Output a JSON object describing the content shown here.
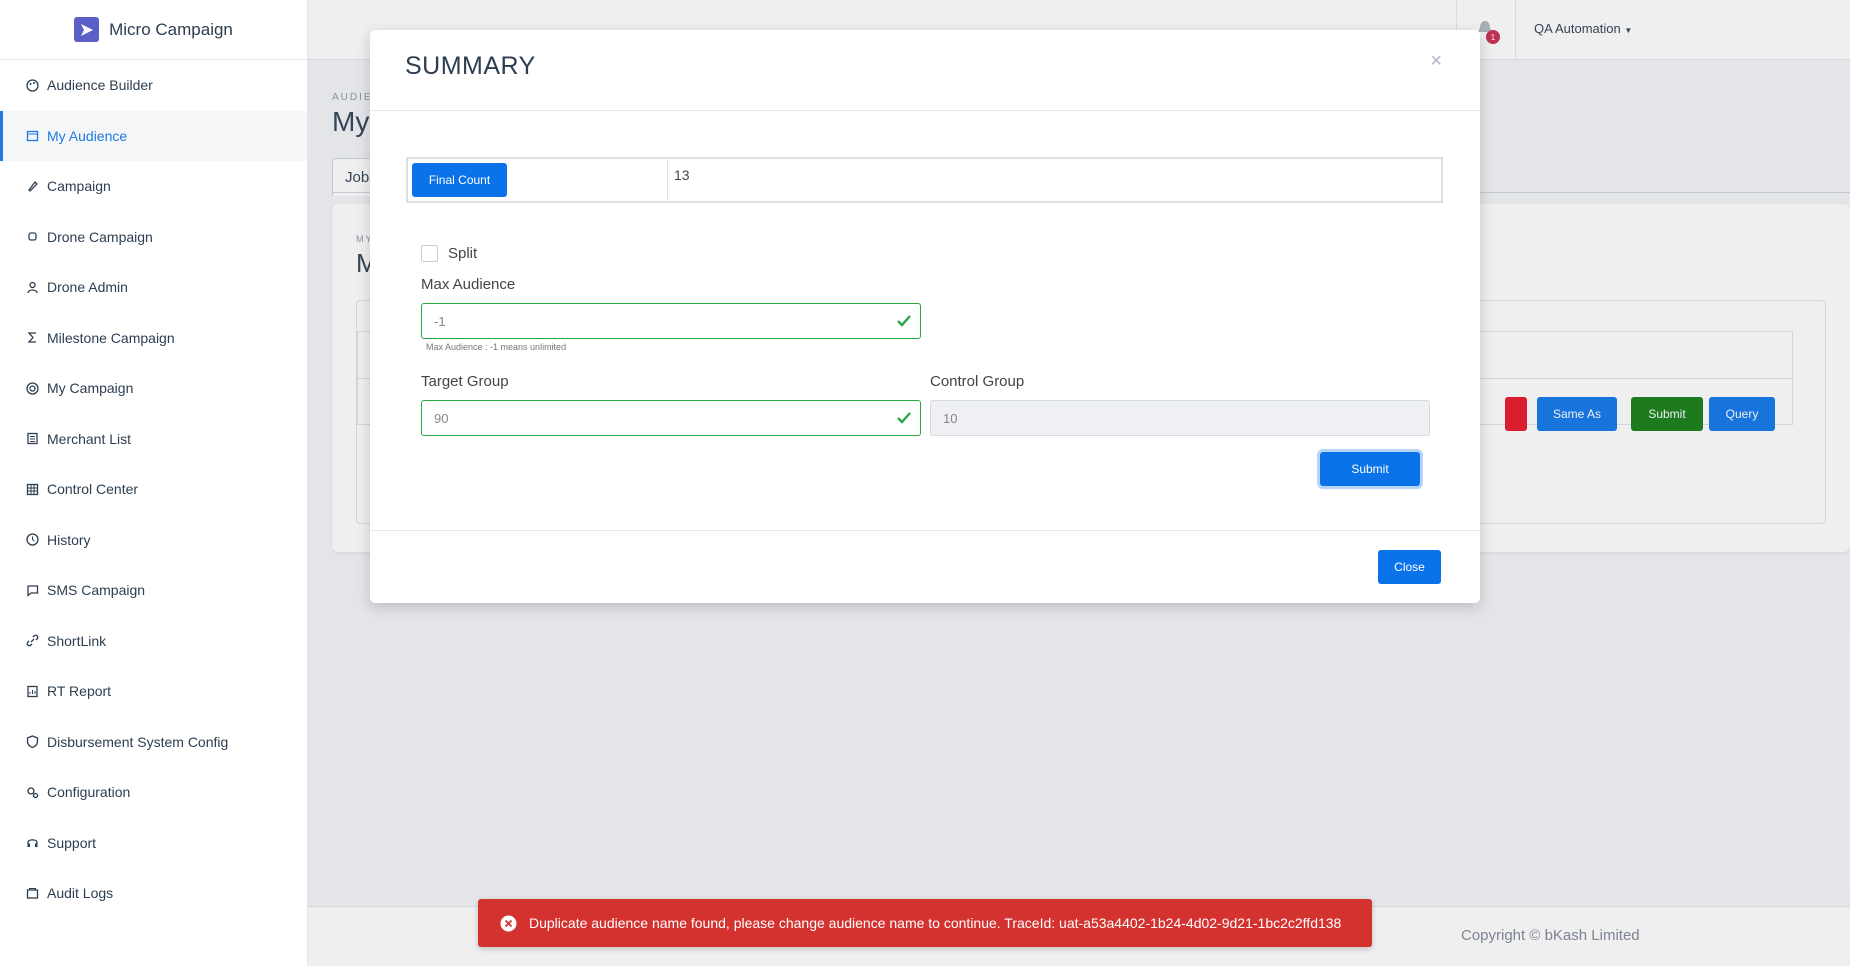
{
  "brand": {
    "name": "Micro Campaign"
  },
  "sidebar": {
    "items": [
      {
        "label": "Audience Builder",
        "icon": "palette-icon",
        "active": false
      },
      {
        "label": "My Audience",
        "icon": "calendar-icon",
        "active": true
      },
      {
        "label": "Campaign",
        "icon": "rocket-icon",
        "active": false
      },
      {
        "label": "Drone Campaign",
        "icon": "drone-icon",
        "active": false
      },
      {
        "label": "Drone Admin",
        "icon": "user-icon",
        "active": false
      },
      {
        "label": "Milestone Campaign",
        "icon": "sigma-icon",
        "active": false
      },
      {
        "label": "My Campaign",
        "icon": "target-icon",
        "active": false
      },
      {
        "label": "Merchant List",
        "icon": "list-icon",
        "active": false
      },
      {
        "label": "Control Center",
        "icon": "grid-icon",
        "active": false
      },
      {
        "label": "History",
        "icon": "history-icon",
        "active": false
      },
      {
        "label": "SMS Campaign",
        "icon": "message-icon",
        "active": false
      },
      {
        "label": "ShortLink",
        "icon": "link-icon",
        "active": false
      },
      {
        "label": "RT Report",
        "icon": "report-icon",
        "active": false
      },
      {
        "label": "Disbursement System Config",
        "icon": "shield-icon",
        "active": false
      },
      {
        "label": "Configuration",
        "icon": "gears-icon",
        "active": false
      },
      {
        "label": "Support",
        "icon": "headset-icon",
        "active": false
      },
      {
        "label": "Audit Logs",
        "icon": "audit-icon",
        "active": false
      }
    ]
  },
  "topbar": {
    "notification_count": "1",
    "user_name": "QA Automation"
  },
  "background": {
    "title_small": "AUDIE",
    "title": "My",
    "tab_label": "Jobs",
    "card_small": "MY",
    "card_title": "M",
    "buttons": {
      "same_as": "Same As",
      "submit": "Submit",
      "query": "Query"
    }
  },
  "modal": {
    "title": "SUMMARY",
    "close_symbol": "×",
    "final_count_label": "Final Count",
    "final_count_value": "13",
    "split_label": "Split",
    "max_audience_label": "Max Audience",
    "max_audience_value": "-1",
    "max_audience_help": "Max Audience : -1 means unlimited",
    "target_group_label": "Target Group",
    "target_group_value": "90",
    "control_group_label": "Control Group",
    "control_group_value": "10",
    "submit_label": "Submit",
    "close_label": "Close"
  },
  "toast": {
    "message": "Duplicate audience name found, please change audience name to continue. TraceId: uat-a53a4402-1b24-4d02-9d21-1bc2c2ffd138"
  },
  "footer": {
    "copyright": "Copyright © bKash Limited"
  },
  "colors": {
    "primary": "#0a73ea",
    "success": "#28a745",
    "danger": "#d3322f",
    "green_btn": "#107c10",
    "red_btn": "#e81123"
  }
}
